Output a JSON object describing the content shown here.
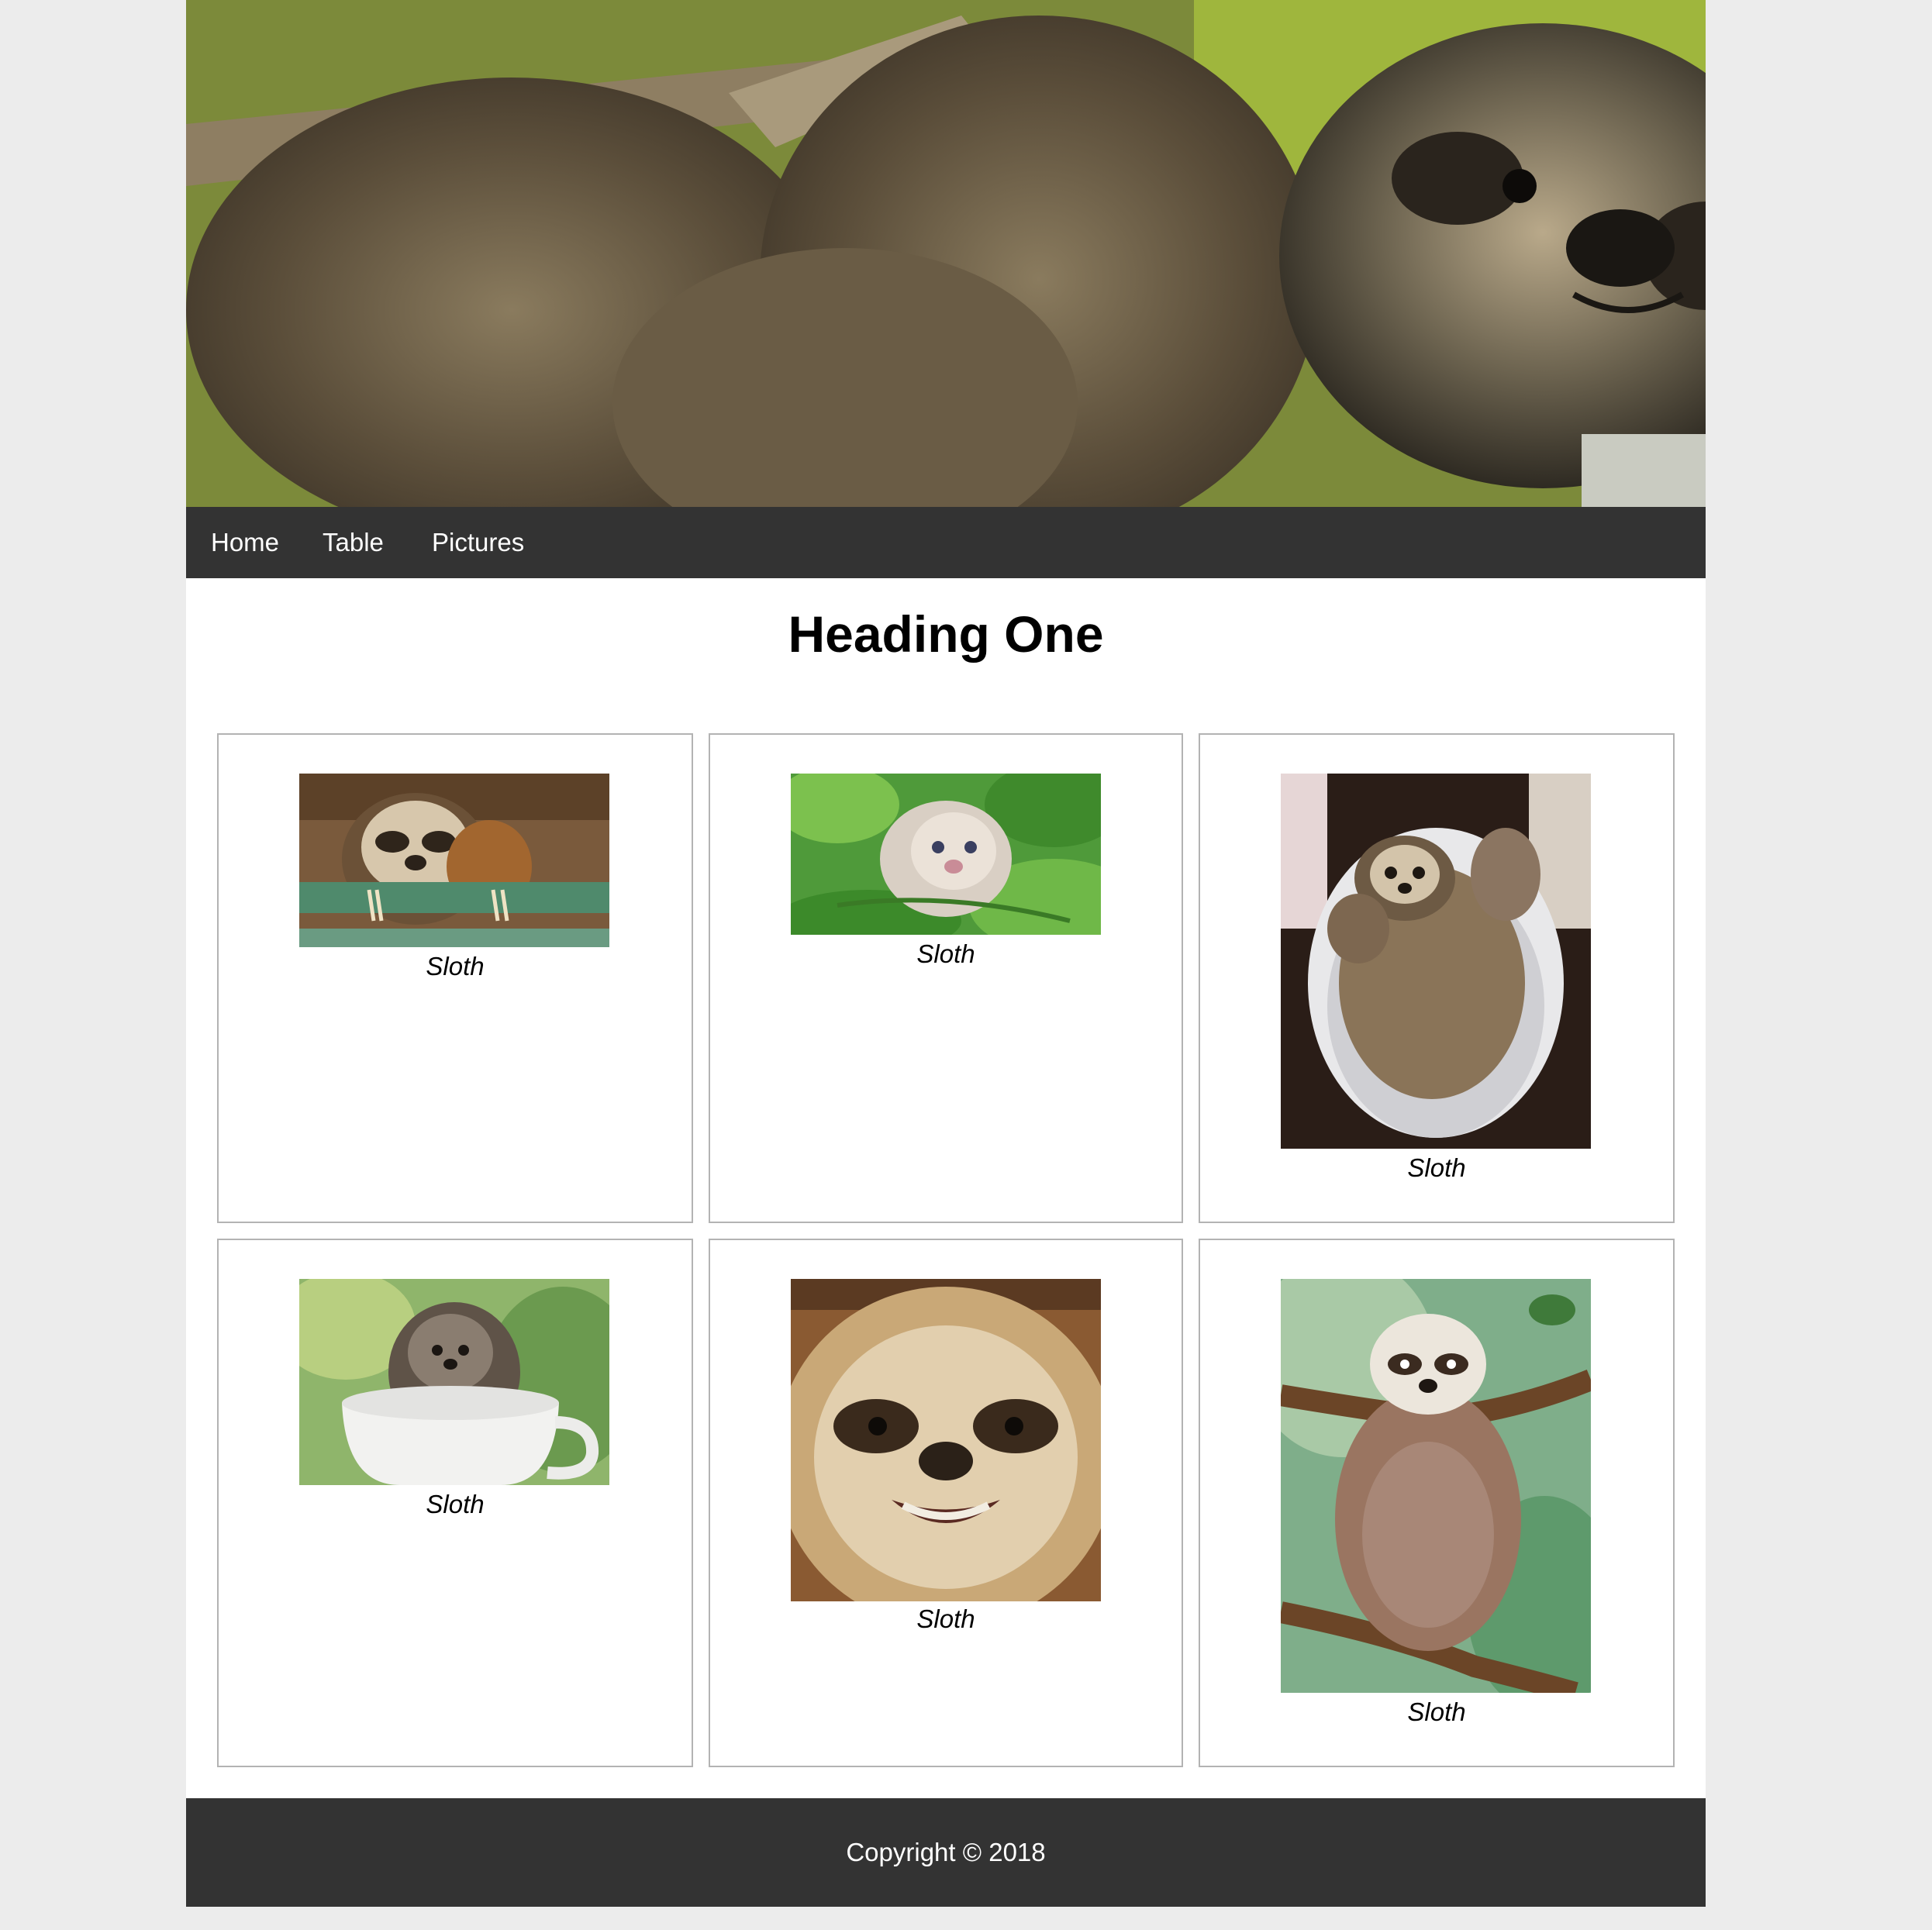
{
  "nav": {
    "items": [
      {
        "label": "Home"
      },
      {
        "label": "Table"
      },
      {
        "label": "Pictures"
      }
    ]
  },
  "main": {
    "heading": "Heading One",
    "gallery": [
      {
        "caption": "Sloth",
        "image": "baby-sloth-on-rail-photo"
      },
      {
        "caption": "Sloth",
        "image": "baby-sloth-in-leaves-photo"
      },
      {
        "caption": "Sloth",
        "image": "sloth-in-bucket-photo"
      },
      {
        "caption": "Sloth",
        "image": "sloth-in-teacup-photo"
      },
      {
        "caption": "Sloth",
        "image": "smiling-sloth-photo"
      },
      {
        "caption": "Sloth",
        "image": "sloth-on-branch-painting"
      }
    ]
  },
  "footer": {
    "copyright": "Copyright © 2018"
  }
}
